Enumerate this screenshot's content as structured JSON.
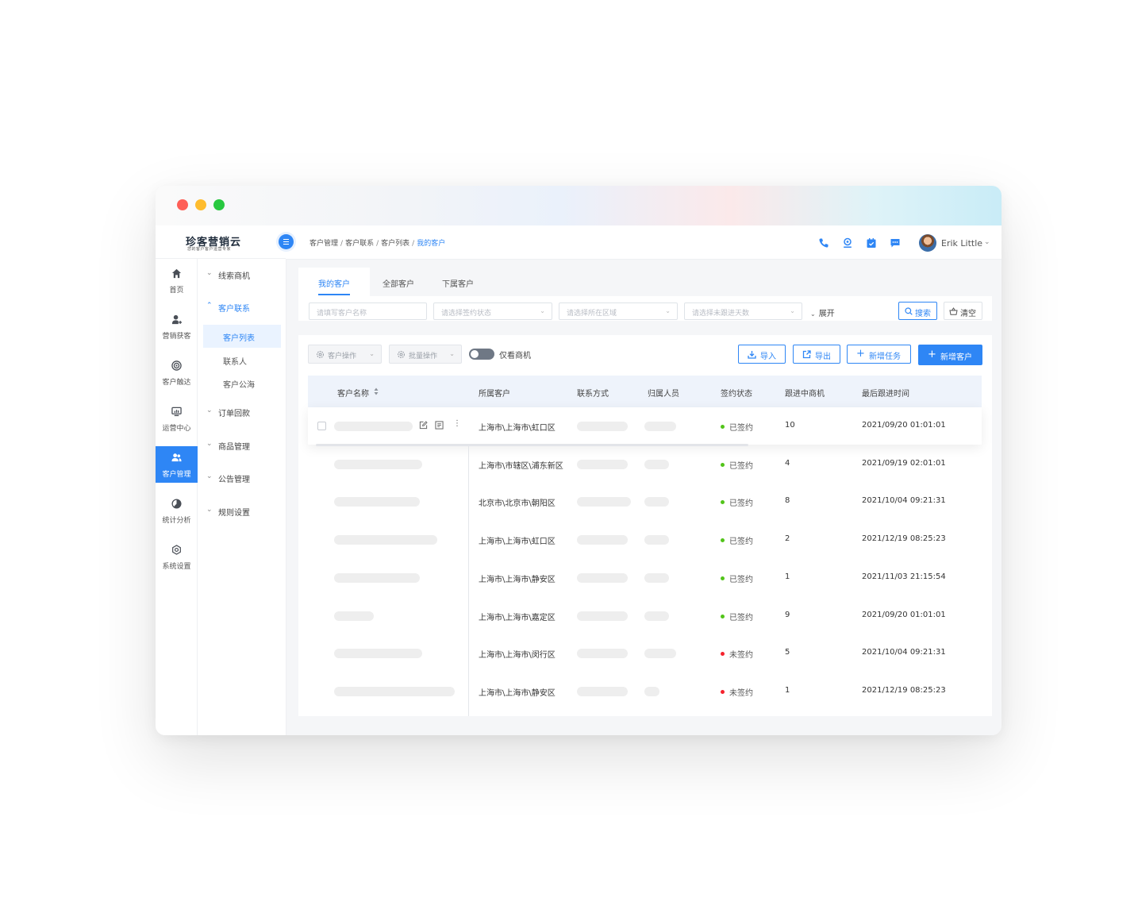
{
  "logo": {
    "main": "珍客营销云",
    "sub": "您的客户客户运营专家"
  },
  "icon_nav": [
    {
      "label": "首页",
      "icon": "home-icon"
    },
    {
      "label": "营销获客",
      "icon": "user-add-icon"
    },
    {
      "label": "客户触达",
      "icon": "target-icon"
    },
    {
      "label": "运营中心",
      "icon": "monitor-icon"
    },
    {
      "label": "客户管理",
      "icon": "users-icon",
      "active": true
    },
    {
      "label": "统计分析",
      "icon": "pie-chart-icon"
    },
    {
      "label": "系统设置",
      "icon": "settings-icon"
    }
  ],
  "sub_nav": {
    "groups": [
      {
        "label": "线索商机",
        "open": false
      },
      {
        "label": "客户联系",
        "open": true
      },
      {
        "label": "订单回款",
        "open": false
      },
      {
        "label": "商品管理",
        "open": false
      },
      {
        "label": "公告管理",
        "open": false
      },
      {
        "label": "规则设置",
        "open": false
      }
    ],
    "items": [
      {
        "label": "客户列表",
        "active": true
      },
      {
        "label": "联系人"
      },
      {
        "label": "客户公海"
      }
    ]
  },
  "breadcrumb": [
    "客户管理",
    "客户联系",
    "客户列表",
    "我的客户"
  ],
  "header": {
    "icons": [
      "phone-icon",
      "location-icon",
      "calendar-icon",
      "message-icon"
    ],
    "user_name": "Erik Little"
  },
  "tabs": [
    "我的客户",
    "全部客户",
    "下属客户"
  ],
  "filters": {
    "name_placeholder": "请填写客户名称",
    "sign_status_placeholder": "请选择签约状态",
    "region_placeholder": "请选择所在区域",
    "days_placeholder": "请选择未跟进天数",
    "expand_label": "展开",
    "search_label": "搜索",
    "clear_label": "清空"
  },
  "toolbar": {
    "customer_ops": "客户操作",
    "batch_ops": "批量操作",
    "only_opportunity": "仅看商机",
    "import": "导入",
    "export": "导出",
    "add_task": "新增任务",
    "add_customer": "新增客户"
  },
  "table": {
    "columns": [
      "客户名称",
      "所属客户",
      "联系方式",
      "归属人员",
      "签约状态",
      "跟进中商机",
      "最后跟进时间"
    ],
    "rows": [
      {
        "region": "上海市\\上海市\\虹口区",
        "status": "已签约",
        "signed": true,
        "opps": "10",
        "last": "2021/09/20 01:01:01"
      },
      {
        "region": "上海市\\市辖区\\浦东新区",
        "status": "已签约",
        "signed": true,
        "opps": "4",
        "last": "2021/09/19 02:01:01"
      },
      {
        "region": "北京市\\北京市\\朝阳区",
        "status": "已签约",
        "signed": true,
        "opps": "8",
        "last": "2021/10/04 09:21:31"
      },
      {
        "region": "上海市\\上海市\\虹口区",
        "status": "已签约",
        "signed": true,
        "opps": "2",
        "last": "2021/12/19 08:25:23"
      },
      {
        "region": "上海市\\上海市\\静安区",
        "status": "已签约",
        "signed": true,
        "opps": "1",
        "last": "2021/11/03 21:15:54"
      },
      {
        "region": "上海市\\上海市\\嘉定区",
        "status": "已签约",
        "signed": true,
        "opps": "9",
        "last": "2021/09/20 01:01:01"
      },
      {
        "region": "上海市\\上海市\\闵行区",
        "status": "未签约",
        "signed": false,
        "opps": "5",
        "last": "2021/10/04 09:21:31"
      },
      {
        "region": "上海市\\上海市\\静安区",
        "status": "未签约",
        "signed": false,
        "opps": "1",
        "last": "2021/12/19 08:25:23"
      }
    ]
  },
  "colors": {
    "accent": "#2e86f5",
    "signed": "#52c41a",
    "unsigned": "#f5222d"
  }
}
